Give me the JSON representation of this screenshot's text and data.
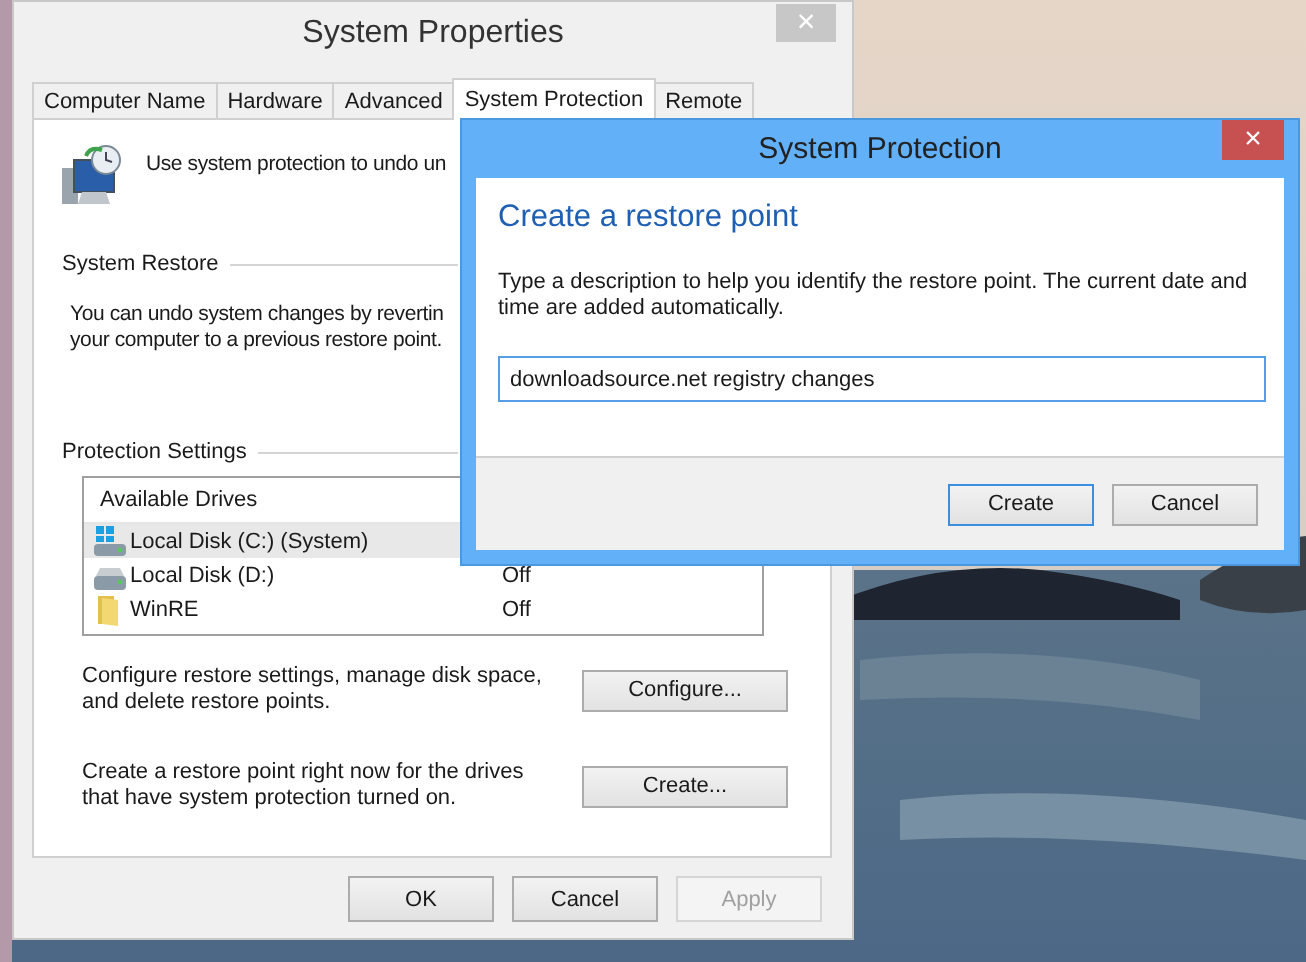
{
  "window": {
    "title": "System Properties",
    "close_glyph": "×"
  },
  "tabs": [
    {
      "label": "Computer Name",
      "selected": false
    },
    {
      "label": "Hardware",
      "selected": false
    },
    {
      "label": "Advanced",
      "selected": false
    },
    {
      "label": "System Protection",
      "selected": true
    },
    {
      "label": "Remote",
      "selected": false
    }
  ],
  "intro": "Use system protection to undo un",
  "system_restore": {
    "heading": "System Restore",
    "lines": [
      "You can undo system changes by revertin",
      "your computer to a previous restore point."
    ]
  },
  "protection": {
    "heading": "Protection Settings",
    "column": "Available Drives",
    "drives": [
      {
        "name": "Local Disk (C:) (System)",
        "kind": "system",
        "selected": true
      },
      {
        "name": "Local Disk (D:)",
        "kind": "disk",
        "status": "Off",
        "selected": false
      },
      {
        "name": "WinRE",
        "kind": "folder",
        "status": "Off",
        "selected": false
      }
    ],
    "actions": [
      {
        "text": "Configure restore settings, manage disk space, and delete restore points.",
        "button": "Configure..."
      },
      {
        "text": "Create a restore point right now for the drives that have system protection turned on.",
        "button": "Create..."
      }
    ]
  },
  "buttons": [
    {
      "label": "OK",
      "disabled": false
    },
    {
      "label": "Cancel",
      "disabled": false
    },
    {
      "label": "Apply",
      "disabled": true
    }
  ],
  "dialog": {
    "title": "System Protection",
    "close_glyph": "×",
    "heading": "Create a restore point",
    "description": "Type a description to help you identify the restore point. The current date and time are added automatically.",
    "value": "downloadsource.net registry changes",
    "buttons": [
      {
        "label": "Create",
        "default": true
      },
      {
        "label": "Cancel",
        "default": false
      }
    ]
  }
}
